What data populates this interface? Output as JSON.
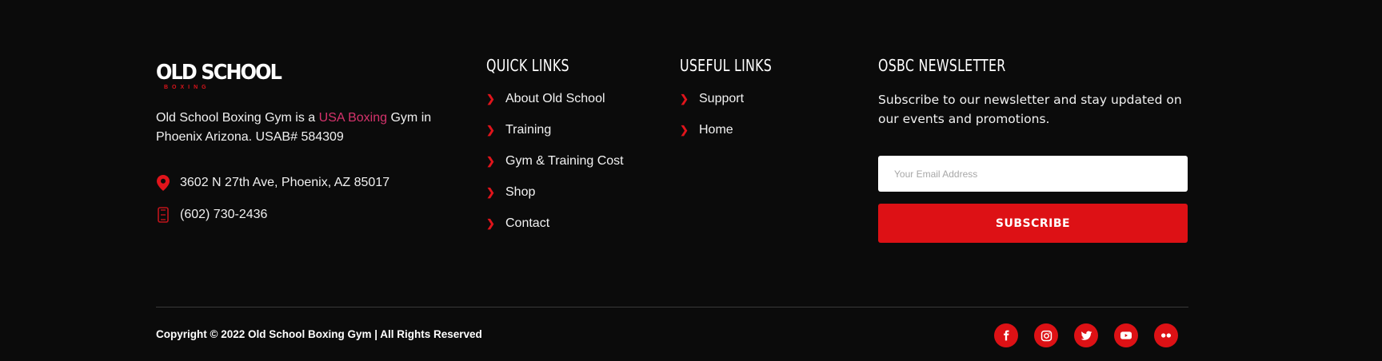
{
  "brand": {
    "logo_text": "OLD SCHOOL",
    "logo_subtext": "BOXING",
    "accent_color": "#dd1115",
    "link_color": "#d6336c",
    "background": "#0b0b0b"
  },
  "about": {
    "text_before": "Old School Boxing Gym is a ",
    "link_text": "USA Boxing",
    "text_after": " Gym in Phoenix Arizona. USAB# 584309"
  },
  "contact": {
    "address": "3602 N 27th Ave, Phoenix, AZ 85017",
    "phone": "(602) 730-2436",
    "address_icon": "map-pin-icon",
    "phone_icon": "phone-icon"
  },
  "quick_links": {
    "title": "QUICK LINKS",
    "items": [
      "About Old School",
      "Training",
      "Gym & Training Cost",
      "Shop",
      "Contact"
    ]
  },
  "useful_links": {
    "title": "USEFUL LINKS",
    "items": [
      "Support",
      "Home"
    ]
  },
  "newsletter": {
    "title": "OSBC NEWSLETTER",
    "text": "Subscribe to our newsletter and stay updated on our events and promotions.",
    "email_placeholder": "Your Email Address",
    "button_label": "SUBSCRIBE"
  },
  "footer": {
    "copyright": "Copyright © 2022 Old School Boxing Gym | All Rights Reserved",
    "socials": [
      "facebook-icon",
      "instagram-icon",
      "twitter-icon",
      "youtube-icon",
      "flickr-icon"
    ]
  }
}
